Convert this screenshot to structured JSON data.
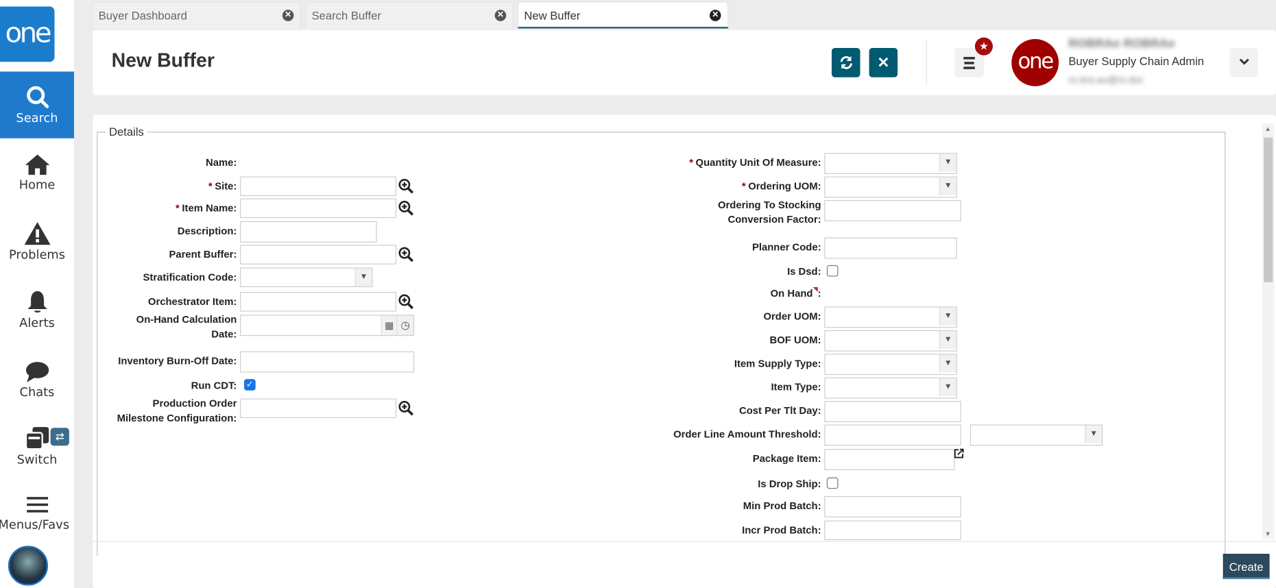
{
  "sidebar": {
    "logo": "one",
    "items": [
      {
        "label": "Search",
        "icon": "search-icon",
        "active": true
      },
      {
        "label": "Home",
        "icon": "home-icon"
      },
      {
        "label": "Problems",
        "icon": "warning-icon"
      },
      {
        "label": "Alerts",
        "icon": "bell-icon"
      },
      {
        "label": "Chats",
        "icon": "chat-icon"
      },
      {
        "label": "Switch",
        "icon": "switch-icon"
      },
      {
        "label": "Menus/Favs",
        "icon": "menu-icon"
      }
    ]
  },
  "tabs": [
    {
      "label": "Buyer Dashboard"
    },
    {
      "label": "Search Buffer"
    },
    {
      "label": "New Buffer",
      "active": true
    }
  ],
  "header": {
    "title": "New Buffer",
    "user_name": "ROBRAe ROBRAe",
    "user_role": "Buyer Supply Chain Admin",
    "user_email": "ro.bra.au@ro.dut",
    "avatar_text": "one"
  },
  "form": {
    "legend": "Details",
    "left": {
      "name": "Name:",
      "site": "Site:",
      "item_name": "Item Name:",
      "description": "Description:",
      "parent_buffer": "Parent Buffer:",
      "stratification_code": "Stratification Code:",
      "orchestrator_item": "Orchestrator Item:",
      "on_hand_calc_date_1": "On-Hand Calculation",
      "on_hand_calc_date_2": "Date:",
      "inventory_burn_off_date": "Inventory Burn-Off Date:",
      "run_cdt": "Run CDT:",
      "run_cdt_checked": true,
      "prod_order_1": "Production Order",
      "prod_order_2": "Milestone Configuration:"
    },
    "right": {
      "quantity_uom": "Quantity Unit Of Measure:",
      "ordering_uom": "Ordering UOM:",
      "conv_1": "Ordering To Stocking",
      "conv_2": "Conversion Factor:",
      "planner_code": "Planner Code:",
      "is_dsd": "Is Dsd:",
      "is_dsd_checked": false,
      "on_hand": "On Hand",
      "colon": ":",
      "order_uom": "Order UOM:",
      "bof_uom": "BOF UOM:",
      "item_supply_type": "Item Supply Type:",
      "item_type": "Item Type:",
      "cost_per_tlt_day": "Cost Per Tlt Day:",
      "order_line_amount_threshold": "Order Line Amount Threshold:",
      "package_item": "Package Item:",
      "is_drop_ship": "Is Drop Ship:",
      "is_drop_ship_checked": false,
      "min_prod_batch": "Min Prod Batch:",
      "incr_prod_batch": "Incr Prod Batch:"
    },
    "required_mark": "*"
  },
  "footer": {
    "create_label": "Create"
  },
  "colors": {
    "primary": "#1f7acb",
    "action": "#005a70",
    "required": "#8b0000",
    "create": "#2b4a5e"
  }
}
